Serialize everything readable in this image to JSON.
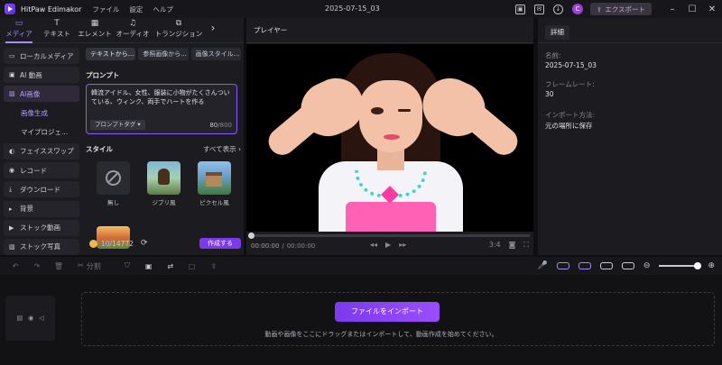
{
  "app": {
    "name": "HitPaw Edimakor",
    "menu": [
      "ファイル",
      "設定",
      "ヘルプ"
    ],
    "doc_title": "2025-07-15_03",
    "avatar_letter": "C",
    "export_label": "エクスポート"
  },
  "tabs": [
    {
      "label": "メディア",
      "icon": "folder-icon",
      "glyph": "▭"
    },
    {
      "label": "テキスト",
      "icon": "text-icon",
      "glyph": "T"
    },
    {
      "label": "エレメント",
      "icon": "elements-icon",
      "glyph": "▦"
    },
    {
      "label": "オーディオ",
      "icon": "music-note-icon",
      "glyph": "♫"
    },
    {
      "label": "トランジション",
      "icon": "transition-icon",
      "glyph": "⧉"
    }
  ],
  "sidenav": [
    {
      "label": "ローカルメディア",
      "glyph": "▭"
    },
    {
      "label": "AI 動画",
      "glyph": "▣"
    },
    {
      "label": "AI画像",
      "glyph": "▨"
    },
    {
      "label": "画像生成"
    },
    {
      "label": "マイプロジェ..."
    },
    {
      "label": "フェイススワップ",
      "glyph": "◐"
    },
    {
      "label": "レコード",
      "glyph": "◉"
    },
    {
      "label": "ダウンロード",
      "glyph": "⤓"
    },
    {
      "label": "背景",
      "glyph": "▸"
    },
    {
      "label": "ストック動画",
      "glyph": "▶"
    },
    {
      "label": "ストック写真",
      "glyph": "▧"
    }
  ],
  "subtabs": [
    "テキストから...",
    "参照画像から...",
    "画像スタイル..."
  ],
  "prompt": {
    "label": "プロンプト",
    "text": "韓流アイドル、女性、服装に小物がたくさんついている、ウィンク、両手でハートを作る",
    "tag_label": "プロンプトタグ ▾",
    "count": "80",
    "max": "/800"
  },
  "style": {
    "label": "スタイル",
    "show_all": "すべて表示 ›",
    "items": [
      "無し",
      "ジブリ風",
      "ピクセル風"
    ]
  },
  "credits": {
    "used": "10",
    "total": "/14772"
  },
  "generate_label": "作成する",
  "player": {
    "title": "プレイヤー",
    "time_current": "00:00:00",
    "time_total": "00:00:00",
    "aspect": "3:4"
  },
  "details": {
    "tab": "詳細",
    "name_label": "名前:",
    "name_value": "2025-07-15_03",
    "fps_label": "フレームレート:",
    "fps_value": "30",
    "import_label": "インポート方法:",
    "import_value": "元の場所に保存"
  },
  "timeline": {
    "split_label": "分割",
    "import_button": "ファイルをインポート",
    "drop_hint": "動画や画像をここにドラッグまたはインポートして、動画作成を始めてください。"
  }
}
